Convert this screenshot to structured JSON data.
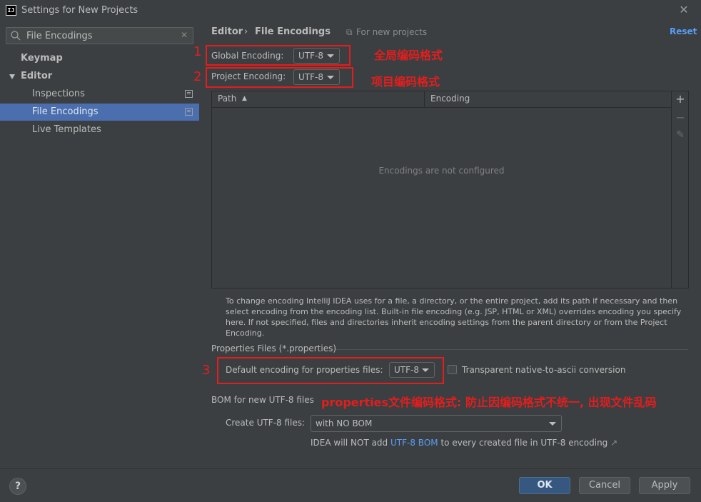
{
  "window": {
    "title": "Settings for New Projects",
    "app_icon_text": "IJ"
  },
  "search": {
    "value": "File Encodings"
  },
  "sidebar": {
    "items": [
      {
        "label": "Keymap"
      },
      {
        "label": "Editor"
      },
      {
        "label": "Inspections"
      },
      {
        "label": "File Encodings"
      },
      {
        "label": "Live Templates"
      }
    ]
  },
  "header": {
    "crumb_parent": "Editor",
    "crumb_sep": "›",
    "crumb_current": "File Encodings",
    "note": "For new projects",
    "reset": "Reset"
  },
  "global_encoding": {
    "label": "Global Encoding:",
    "value": "UTF-8",
    "marker": "1",
    "annotation": "全局编码格式"
  },
  "project_encoding": {
    "label": "Project Encoding:",
    "value": "UTF-8",
    "marker": "2",
    "annotation": "项目编码格式"
  },
  "table": {
    "col_path": "Path",
    "col_path_sort": "▲",
    "col_encoding": "Encoding",
    "empty": "Encodings are not configured",
    "tools": [
      "+",
      "−",
      "✎"
    ]
  },
  "help_text": "To change encoding IntelliJ IDEA uses for a file, a directory, or the entire project, add its path if necessary and then select encoding from the encoding list. Built-in file encoding (e.g. JSP, HTML or XML) overrides encoding you specify here. If not specified, files and directories inherit encoding settings from the parent directory or from the Project Encoding.",
  "properties": {
    "section": "Properties Files (*.properties)",
    "default_label": "Default encoding for properties files:",
    "default_value": "UTF-8",
    "marker": "3",
    "transparent_label": "Transparent native-to-ascii conversion",
    "transparent_checked": false
  },
  "bom": {
    "section": "BOM for new UTF-8 files",
    "annotation": "properties文件编码格式: 防止因编码格式不统一, 出现文件乱码",
    "create_label": "Create UTF-8 files:",
    "create_value": "with NO BOM",
    "note_prefix": "IDEA will NOT add",
    "note_link": "UTF-8 BOM",
    "note_suffix": "to every created file in UTF-8 encoding",
    "note_arrow": "↗"
  },
  "buttons": {
    "help": "?",
    "ok": "OK",
    "cancel": "Cancel",
    "apply": "Apply"
  },
  "colors": {
    "accent": "#4b6eaf",
    "link": "#589df6",
    "annotation_red": "#e41d1d",
    "background": "#3c3f41"
  }
}
